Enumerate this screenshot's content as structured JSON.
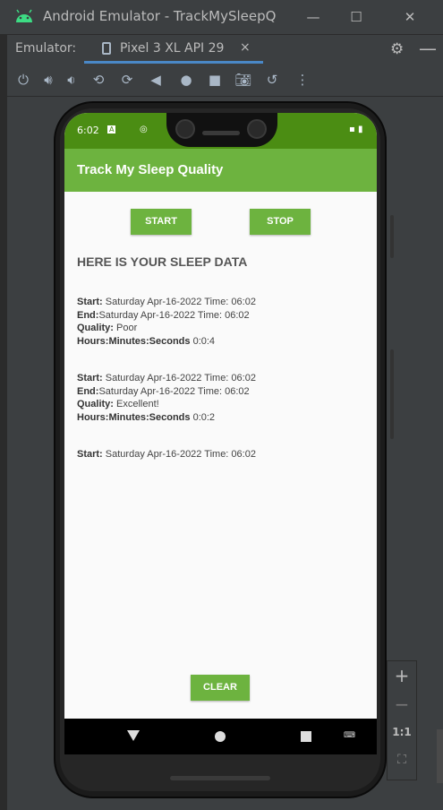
{
  "window": {
    "title": "Android Emulator - TrackMySleepQ"
  },
  "emulator_bar": {
    "label": "Emulator:",
    "device_tab": "Pixel 3 XL API 29",
    "close": "×"
  },
  "status": {
    "time": "6:02",
    "icon_a": "A"
  },
  "app": {
    "title": "Track My Sleep Quality",
    "start_label": "START",
    "stop_label": "STOP",
    "heading": "HERE IS YOUR SLEEP DATA",
    "clear_label": "CLEAR",
    "entries": [
      {
        "start_label": "Start:",
        "start_value": " Saturday Apr-16-2022 Time: 06:02",
        "end_label": "End:",
        "end_value": "Saturday Apr-16-2022 Time: 06:02",
        "quality_label": "Quality:",
        "quality_value": " Poor",
        "hms_label": "Hours:Minutes:Seconds",
        "hms_value": "  0:0:4"
      },
      {
        "start_label": "Start:",
        "start_value": " Saturday Apr-16-2022 Time: 06:02",
        "end_label": "End:",
        "end_value": "Saturday Apr-16-2022 Time: 06:02",
        "quality_label": "Quality:",
        "quality_value": " Excellent!",
        "hms_label": "Hours:Minutes:Seconds",
        "hms_value": "  0:0:2"
      },
      {
        "start_label": "Start:",
        "start_value": " Saturday Apr-16-2022 Time: 06:02"
      }
    ]
  },
  "zoom": {
    "plus": "+",
    "minus": "−",
    "one_to_one": "1:1"
  },
  "colors": {
    "statusbar": "#4b8d13",
    "appbar": "#6db33f",
    "button": "#6db33f"
  }
}
